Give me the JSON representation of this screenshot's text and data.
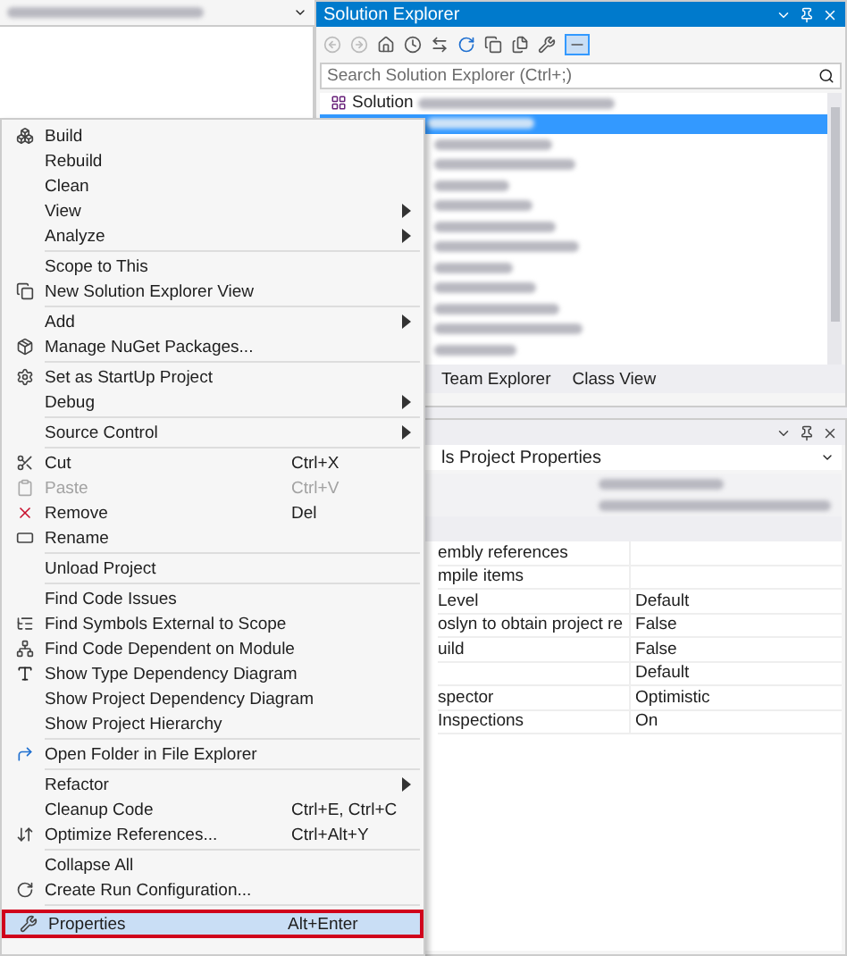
{
  "solution_explorer": {
    "title": "Solution Explorer",
    "search": {
      "placeholder": "Search Solution Explorer (Ctrl+;)"
    },
    "tree": [
      {
        "kind": "text",
        "label": "Solution",
        "selected": false
      },
      {
        "kind": "blurred",
        "selected": true
      },
      {
        "kind": "blurred",
        "selected": false
      },
      {
        "kind": "blurred",
        "selected": false
      },
      {
        "kind": "blurred",
        "selected": false
      },
      {
        "kind": "blurred",
        "selected": false
      },
      {
        "kind": "blurred",
        "selected": false
      },
      {
        "kind": "blurred",
        "selected": false
      },
      {
        "kind": "blurred",
        "selected": false
      },
      {
        "kind": "blurred",
        "selected": false
      },
      {
        "kind": "blurred",
        "selected": false
      },
      {
        "kind": "blurred",
        "selected": false
      },
      {
        "kind": "blurred",
        "selected": false
      }
    ],
    "tabs": [
      {
        "label": "Team Explorer",
        "selected": false
      },
      {
        "label": "Class View",
        "selected": false
      }
    ]
  },
  "properties": {
    "object": "ls Project Properties",
    "rows": [
      {
        "kind": "blurred"
      },
      {
        "kind": "blurred"
      },
      {
        "kind": "category"
      },
      {
        "kind": "prop",
        "name": "embly references",
        "value": ""
      },
      {
        "kind": "prop",
        "name": "mpile items",
        "value": ""
      },
      {
        "kind": "prop",
        "name": "Level",
        "value": "Default"
      },
      {
        "kind": "prop",
        "name": "oslyn to obtain project re",
        "value": "False"
      },
      {
        "kind": "prop",
        "name": "uild",
        "value": "False"
      },
      {
        "kind": "prop",
        "name": "",
        "value": "Default"
      },
      {
        "kind": "prop",
        "name": "spector",
        "value": "Optimistic"
      },
      {
        "kind": "prop",
        "name": "Inspections",
        "value": "On"
      }
    ]
  },
  "context_menu": {
    "groups": [
      [
        {
          "label": "Build",
          "submenu": false,
          "disabled": false,
          "selected": false
        },
        {
          "label": "Rebuild",
          "submenu": false,
          "disabled": false,
          "selected": false
        },
        {
          "label": "Clean",
          "submenu": false,
          "disabled": false,
          "selected": false
        },
        {
          "label": "View",
          "submenu": true,
          "disabled": false,
          "selected": false
        },
        {
          "label": "Analyze",
          "submenu": true,
          "disabled": false,
          "selected": false
        }
      ],
      [
        {
          "label": "Scope to This",
          "submenu": false,
          "disabled": false,
          "selected": false
        },
        {
          "label": "New Solution Explorer View",
          "submenu": false,
          "disabled": false,
          "selected": false
        }
      ],
      [
        {
          "label": "Add",
          "submenu": true,
          "disabled": false,
          "selected": false
        },
        {
          "label": "Manage NuGet Packages...",
          "submenu": false,
          "disabled": false,
          "selected": false
        }
      ],
      [
        {
          "label": "Set as StartUp Project",
          "submenu": false,
          "disabled": false,
          "selected": false
        },
        {
          "label": "Debug",
          "submenu": true,
          "disabled": false,
          "selected": false
        }
      ],
      [
        {
          "label": "Source Control",
          "submenu": true,
          "disabled": false,
          "selected": false
        }
      ],
      [
        {
          "label": "Cut",
          "shortcut": "Ctrl+X",
          "submenu": false,
          "disabled": false,
          "selected": false
        },
        {
          "label": "Paste",
          "shortcut": "Ctrl+V",
          "submenu": false,
          "disabled": true,
          "selected": false
        },
        {
          "label": "Remove",
          "shortcut": "Del",
          "submenu": false,
          "disabled": false,
          "selected": false
        },
        {
          "label": "Rename",
          "submenu": false,
          "disabled": false,
          "selected": false
        }
      ],
      [
        {
          "label": "Unload Project",
          "submenu": false,
          "disabled": false,
          "selected": false
        }
      ],
      [
        {
          "label": "Find Code Issues",
          "submenu": false,
          "disabled": false,
          "selected": false
        },
        {
          "label": "Find Symbols External to Scope",
          "submenu": false,
          "disabled": false,
          "selected": false
        },
        {
          "label": "Find Code Dependent on Module",
          "submenu": false,
          "disabled": false,
          "selected": false
        },
        {
          "label": "Show Type Dependency Diagram",
          "submenu": false,
          "disabled": false,
          "selected": false
        },
        {
          "label": "Show Project Dependency Diagram",
          "submenu": false,
          "disabled": false,
          "selected": false
        },
        {
          "label": "Show Project Hierarchy",
          "submenu": false,
          "disabled": false,
          "selected": false
        }
      ],
      [
        {
          "label": "Open Folder in File Explorer",
          "submenu": false,
          "disabled": false,
          "selected": false
        }
      ],
      [
        {
          "label": "Refactor",
          "submenu": true,
          "disabled": false,
          "selected": false
        },
        {
          "label": "Cleanup Code",
          "shortcut": "Ctrl+E, Ctrl+C",
          "submenu": false,
          "disabled": false,
          "selected": false
        },
        {
          "label": "Optimize References...",
          "shortcut": "Ctrl+Alt+Y",
          "submenu": false,
          "disabled": false,
          "selected": false
        }
      ],
      [
        {
          "label": "Collapse All",
          "submenu": false,
          "disabled": false,
          "selected": false
        },
        {
          "label": "Create Run Configuration...",
          "submenu": false,
          "disabled": false,
          "selected": false
        }
      ],
      [
        {
          "label": "Properties",
          "shortcut": "Alt+Enter",
          "submenu": false,
          "disabled": false,
          "selected": true
        }
      ]
    ]
  }
}
